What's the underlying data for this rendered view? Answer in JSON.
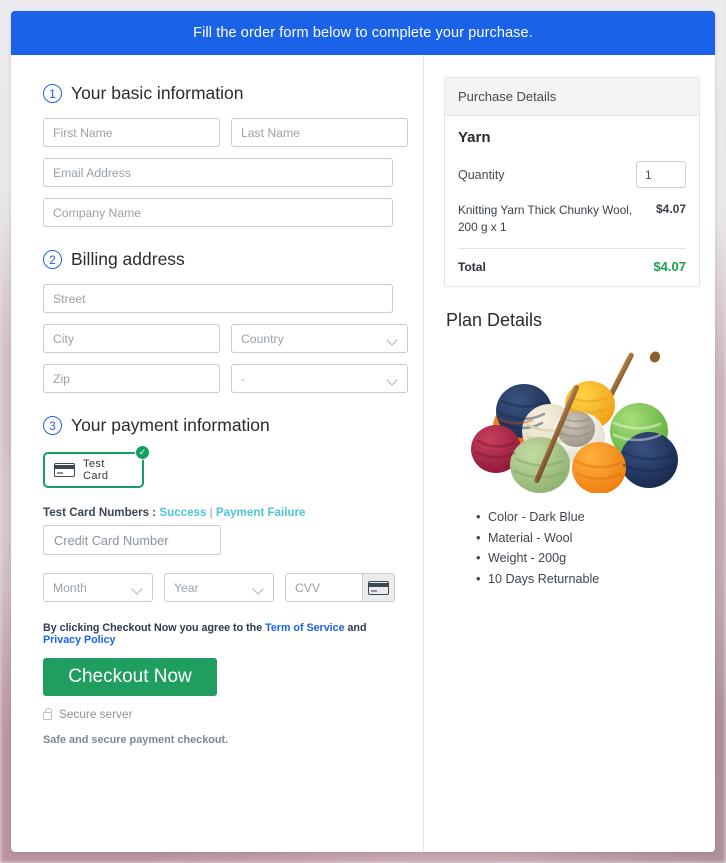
{
  "banner": {
    "text": "Fill the order form below to complete your purchase."
  },
  "sections": {
    "basic": {
      "num": "1",
      "title": "Your basic information"
    },
    "billing": {
      "num": "2",
      "title": "Billing address"
    },
    "payment": {
      "num": "3",
      "title": "Your payment information"
    }
  },
  "fields": {
    "first_name": "First Name",
    "last_name": "Last Name",
    "email": "Email Address",
    "company": "Company Name",
    "street": "Street",
    "city": "City",
    "country": "Country",
    "zip": "Zip",
    "state": "-",
    "card_number": "Credit Card Number",
    "month": "Month",
    "year": "Year",
    "cvv": "CVV"
  },
  "payment": {
    "test_card_label": "Test  Card",
    "card_icon": "credit-card-icon",
    "selected_badge": "✓",
    "test_numbers_prefix": "Test Card Numbers : ",
    "test_success": "Success",
    "test_separator": " | ",
    "test_failure": "Payment Failure",
    "cvv_icon": "credit-card-icon"
  },
  "terms": {
    "lead": "By clicking Checkout Now you agree to the ",
    "tos": "Term of Service",
    "and": " and ",
    "privacy": "Privacy Policy"
  },
  "actions": {
    "checkout_label": "Checkout Now",
    "secure_server": "Secure server",
    "secure_icon": "lock-icon",
    "safe_note": "Safe and secure payment checkout."
  },
  "purchase": {
    "header": "Purchase Details",
    "product": "Yarn",
    "quantity_label": "Quantity",
    "quantity_value": "1",
    "item_desc": "Knitting Yarn Thick Chunky Wool, 200 g x 1",
    "item_price": "$4.07",
    "total_label": "Total",
    "total_value": "$4.07"
  },
  "plan": {
    "title": "Plan Details",
    "image_alt": "yarn-balls-and-knitting-needles-photo",
    "features": [
      "Color - Dark Blue",
      "Material - Wool",
      "Weight - 200g",
      "10 Days Returnable"
    ]
  },
  "colors": {
    "banner_blue": "#1a62e8",
    "accent_blue": "#1a62e8",
    "checkout_green": "#1f9e5f",
    "total_green": "#17a34a",
    "test_card_green": "#13a160",
    "link_teal": "#4cc6d8"
  }
}
